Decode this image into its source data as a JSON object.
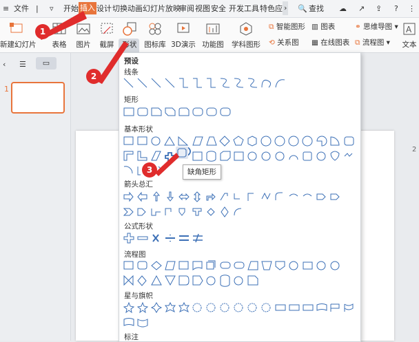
{
  "menubar": {
    "hamburger": "≡",
    "file": "文件",
    "items": [
      "开始",
      "插入",
      "设计",
      "切换",
      "动画",
      "幻灯片放映",
      "审阅",
      "视图",
      "安全",
      "开发工具",
      "特色应"
    ],
    "search": "查找"
  },
  "ribbon": {
    "new_slide": "新建幻灯片",
    "table": "表格",
    "picture": "图片",
    "screenshot": "截屏",
    "shapes": "形状",
    "icon_lib": "图标库",
    "3d": "3D演示",
    "function_chart": "功能图",
    "subject_chart": "学科图形",
    "smart_art": "智能图形",
    "chart": "图表",
    "mindmap": "思维导图",
    "text": "文本",
    "relation": "关系图",
    "online_chart": "在线图表",
    "flowchart": "流程图"
  },
  "thumbnail_number": "1",
  "dropdown": {
    "preset": "预设",
    "sections": [
      "线条",
      "矩形",
      "基本形状",
      "箭头总汇",
      "公式形状",
      "流程图",
      "星与旗帜",
      "标注"
    ]
  },
  "tooltip": "缺角矩形",
  "badges": [
    "1",
    "2",
    "3"
  ],
  "colors": {
    "accent": "#e8743b",
    "badge": "#e02c2c",
    "shape_stroke": "#3b6fb6"
  }
}
